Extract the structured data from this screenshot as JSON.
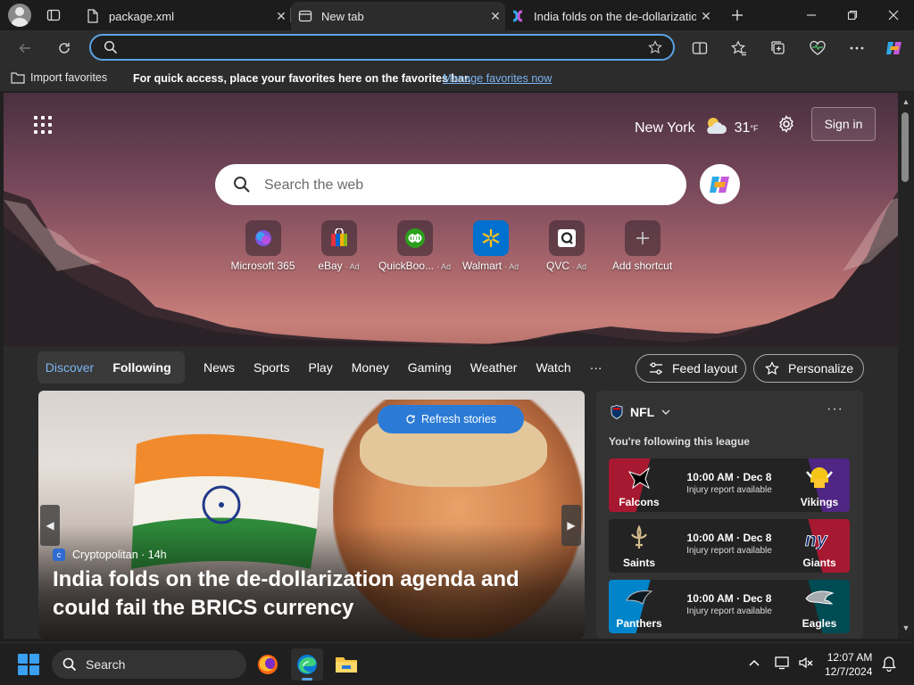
{
  "tabs": [
    {
      "label": "package.xml",
      "icon": "document-icon",
      "active": false
    },
    {
      "label": "New tab",
      "icon": "newtab-icon",
      "active": true
    },
    {
      "label": "India folds on the de-dollarization",
      "icon": "copilot-icon",
      "active": false
    }
  ],
  "address": {
    "value": "",
    "placeholder": ""
  },
  "favorites_bar": {
    "import_label": "Import favorites",
    "message": "For quick access, place your favorites here on the favorites bar.",
    "link": "Manage favorites now"
  },
  "header": {
    "city": "New York",
    "temp": "31",
    "unit": "°F",
    "sign_in": "Sign in"
  },
  "search": {
    "placeholder": "Search the web"
  },
  "shortcuts": [
    {
      "name": "Microsoft 365",
      "ad": ""
    },
    {
      "name": "eBay",
      "ad": "· Ad"
    },
    {
      "name": "QuickBoo...",
      "ad": "· Ad"
    },
    {
      "name": "Walmart",
      "ad": "· Ad"
    },
    {
      "name": "QVC",
      "ad": "· Ad"
    },
    {
      "name": "Add shortcut",
      "ad": ""
    }
  ],
  "feed_nav": {
    "discover": "Discover",
    "following": "Following",
    "items": [
      "News",
      "Sports",
      "Play",
      "Money",
      "Gaming",
      "Weather",
      "Watch",
      "···"
    ],
    "feed_layout": "Feed layout",
    "personalize": "Personalize"
  },
  "hero": {
    "refresh": "Refresh stories",
    "source": "Cryptopolitan",
    "age": "· 14h",
    "headline": "India folds on the de-dollarization agenda and could fail the BRICS currency"
  },
  "nfl": {
    "title": "NFL",
    "note": "You're following this league",
    "more": "···",
    "games": [
      {
        "home": "Falcons",
        "away": "Vikings",
        "time": "10:00 AM · Dec 8",
        "status": "Injury report available",
        "home_color": "#a71930",
        "away_color": "#4f2683"
      },
      {
        "home": "Saints",
        "away": "Giants",
        "time": "10:00 AM · Dec 8",
        "status": "Injury report available",
        "home_color": "#2a2a2a",
        "away_color": "#a71930"
      },
      {
        "home": "Panthers",
        "away": "Eagles",
        "time": "10:00 AM · Dec 8",
        "status": "Injury report available",
        "home_color": "#0085ca",
        "away_color": "#004c54"
      }
    ]
  },
  "taskbar": {
    "search": "Search",
    "time": "12:07 AM",
    "date": "12/7/2024"
  }
}
